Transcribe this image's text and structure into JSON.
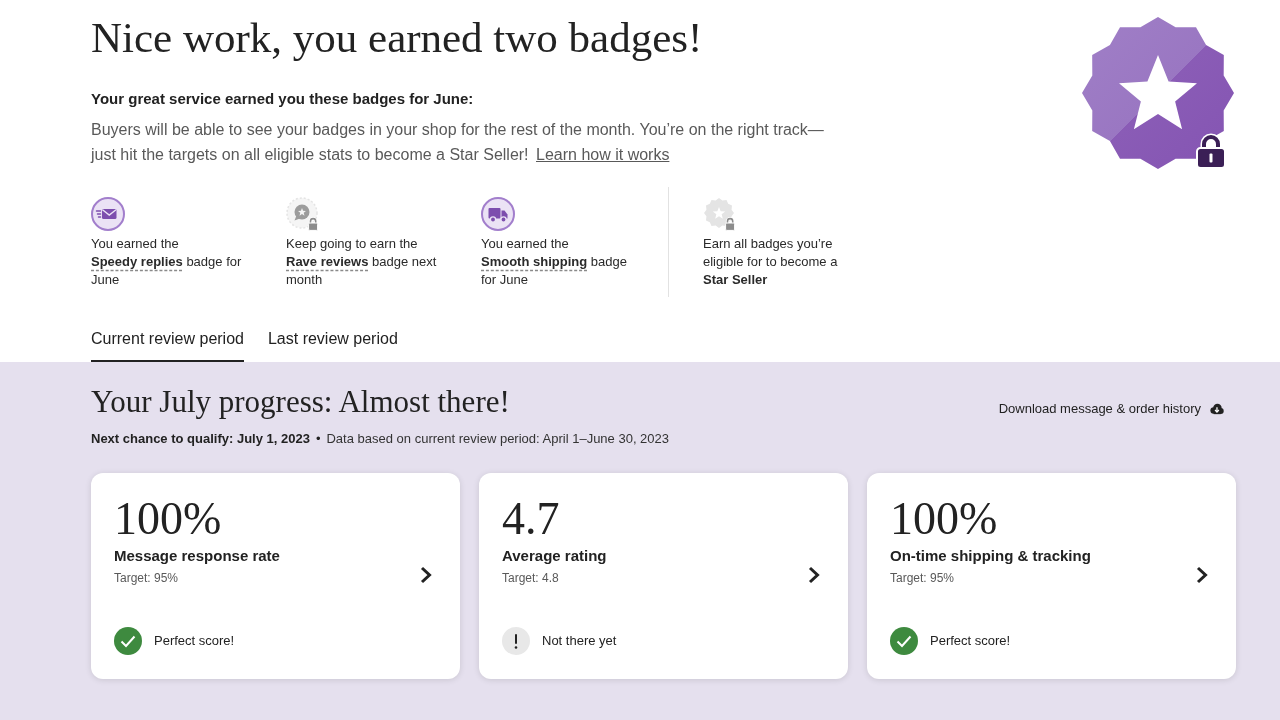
{
  "header": {
    "title": "Nice work, you earned two badges!",
    "subtitle": "Your great service earned you these badges for June:",
    "description": "Buyers will be able to see your badges in your shop for the rest of the month. You’re on the right track—just hit the targets on all eligible stats to become a Star Seller!",
    "link": "Learn how it works"
  },
  "hero_badge": {
    "locked": true
  },
  "badges": [
    {
      "kind": "messages",
      "earned": true,
      "before": "You earned the",
      "badge_name": "Speedy replies",
      "after": "badge for June"
    },
    {
      "kind": "reviews",
      "earned": false,
      "before": "Keep going to earn the",
      "badge_name": "Rave reviews",
      "after": "badge next month"
    },
    {
      "kind": "shipping",
      "earned": true,
      "before": "You earned the",
      "badge_name": "Smooth shipping",
      "after": "badge for June"
    },
    {
      "kind": "star_seller",
      "earned": false,
      "text": "Earn all badges you’re eligible for to become a **Star Seller**"
    }
  ],
  "tabs": [
    {
      "label": "Current review period",
      "selected": true
    },
    {
      "label": "Last review period",
      "selected": false
    }
  ],
  "progress": {
    "title": "Your July progress: Almost there!",
    "download": "Download message & order history",
    "next_chance": "Next chance to qualify: July 1, 2023",
    "separator": "•",
    "data_note": "Data based on current review period: April 1–June 30, 2023",
    "cards": [
      {
        "value": "100%",
        "label": "Message response rate",
        "target": "Target: 95%",
        "met": true,
        "status": "Perfect score!"
      },
      {
        "value": "4.7",
        "label": "Average rating",
        "target": "Target: 4.8",
        "met": false,
        "status": "Not there yet"
      },
      {
        "value": "100%",
        "label": "On-time shipping & tracking",
        "target": "Target: 95%",
        "met": true,
        "status": "Perfect score!"
      }
    ]
  }
}
